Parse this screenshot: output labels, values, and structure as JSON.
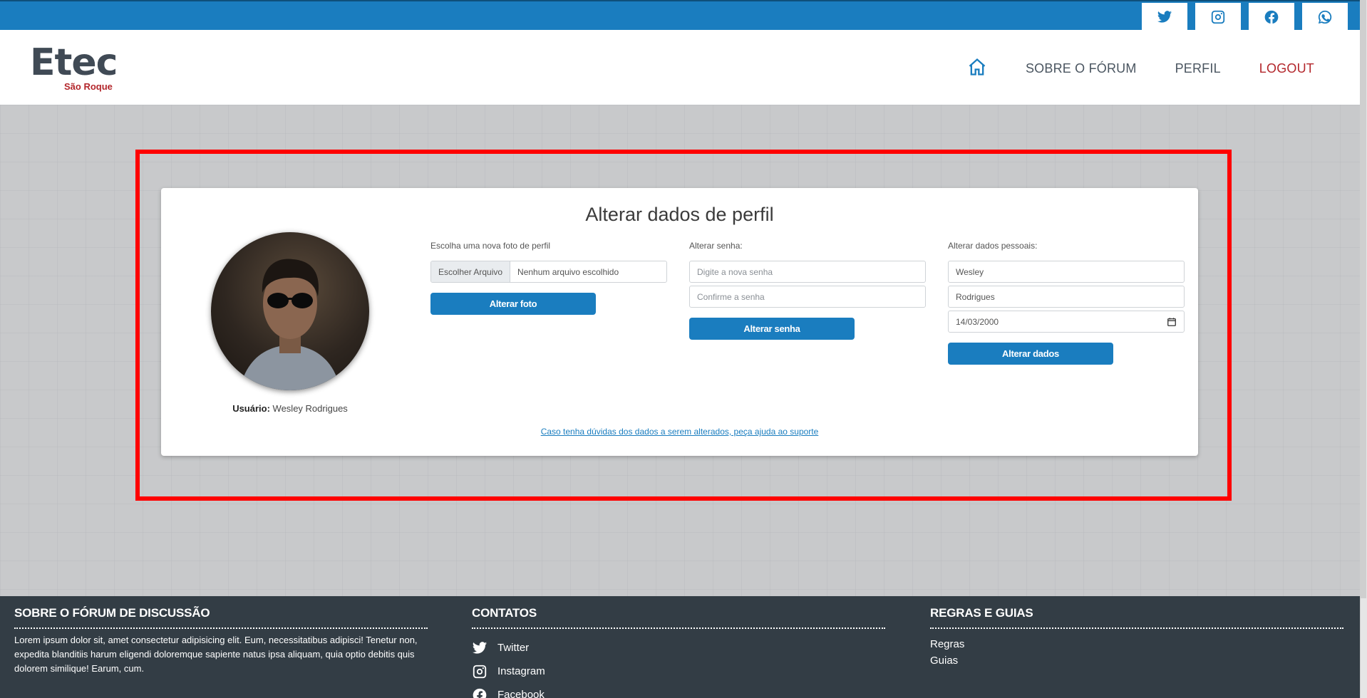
{
  "topbar": {
    "social": [
      {
        "name": "twitter-icon"
      },
      {
        "name": "instagram-icon"
      },
      {
        "name": "facebook-icon"
      },
      {
        "name": "whatsapp-icon"
      }
    ]
  },
  "header": {
    "logo_main": "Etec",
    "logo_sub": "São Roque",
    "nav": {
      "home_icon": "home-icon",
      "about": "SOBRE O FÓRUM",
      "profile": "PERFIL",
      "logout": "LOGOUT"
    }
  },
  "profile_card": {
    "title": "Alterar dados de perfil",
    "user_label": "Usuário:",
    "user_name": "Wesley Rodrigues",
    "photo": {
      "label": "Escolha uma nova foto de perfil",
      "choose_button": "Escolher Arquivo",
      "no_file_text": "Nenhum arquivo escolhido",
      "submit": "Alterar foto"
    },
    "password": {
      "label": "Alterar senha:",
      "new_placeholder": "Digite a nova senha",
      "confirm_placeholder": "Confirme a senha",
      "submit": "Alterar senha"
    },
    "personal": {
      "label": "Alterar dados pessoais:",
      "first_name": "Wesley",
      "last_name": "Rodrigues",
      "birth_date": "14/03/2000",
      "submit": "Alterar dados"
    },
    "help_link": "Caso tenha dúvidas dos dados a serem alterados, peça ajuda ao suporte"
  },
  "footer": {
    "about": {
      "title": "SOBRE O FÓRUM DE DISCUSSÃO",
      "text": "Lorem ipsum dolor sit, amet consectetur adipisicing elit. Eum, necessitatibus adipisci! Tenetur non, expedita blanditiis harum eligendi doloremque sapiente natus ipsa aliquam, quia optio debitis quis dolorem similique! Earum, cum."
    },
    "contacts": {
      "title": "CONTATOS",
      "items": [
        "Twitter",
        "Instagram",
        "Facebook"
      ]
    },
    "rules": {
      "title": "REGRAS E GUIAS",
      "items": [
        "Regras",
        "Guias"
      ]
    }
  },
  "colors": {
    "brand_blue": "#1a7dbf",
    "logout_red": "#b3262b",
    "highlight_red": "#ff0000",
    "footer_bg": "#333d45"
  }
}
